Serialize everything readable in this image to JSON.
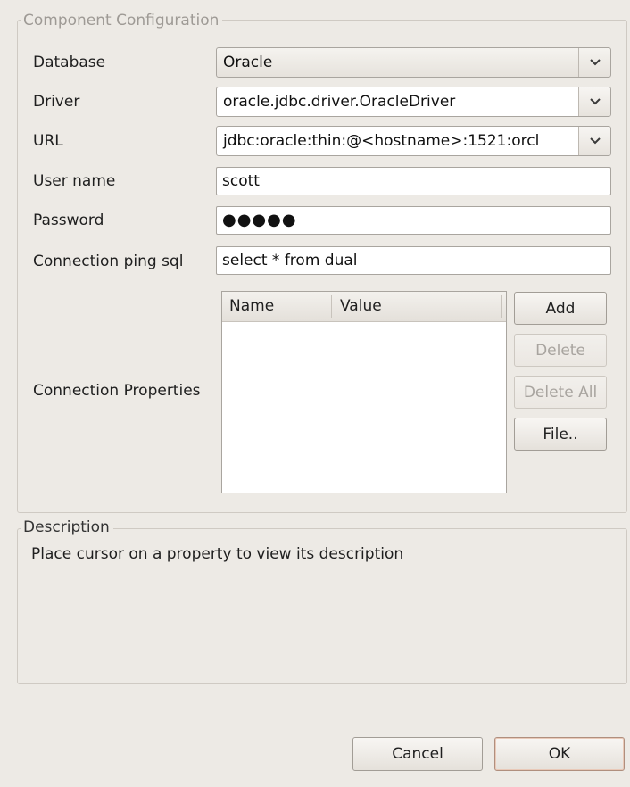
{
  "component_config": {
    "legend": "Component Configuration",
    "fields": {
      "database": {
        "label": "Database",
        "value": "Oracle"
      },
      "driver": {
        "label": "Driver",
        "value": "oracle.jdbc.driver.OracleDriver"
      },
      "url": {
        "label": "URL",
        "value": "jdbc:oracle:thin:@<hostname>:1521:orcl"
      },
      "username": {
        "label": "User name",
        "value": "scott"
      },
      "password": {
        "label": "Password",
        "value": "●●●●●"
      },
      "ping_sql": {
        "label": "Connection ping sql",
        "value": "select * from dual"
      }
    },
    "connection_properties": {
      "label": "Connection Properties",
      "columns": [
        "Name",
        "Value"
      ],
      "rows": [],
      "buttons": {
        "add": "Add",
        "delete": "Delete",
        "delete_all": "Delete All",
        "file": "File.."
      }
    }
  },
  "description": {
    "legend": "Description",
    "text": "Place cursor on a property to view its description"
  },
  "footer": {
    "cancel": "Cancel",
    "ok": "OK"
  },
  "icons": {
    "dropdown": "chevron-down-icon"
  }
}
